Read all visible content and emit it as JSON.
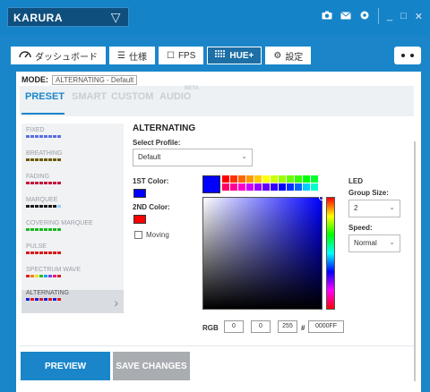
{
  "titlebar": {
    "device": "KARURA",
    "icons": [
      "camera-icon",
      "mail-icon",
      "gear-icon"
    ],
    "window_buttons": [
      "_",
      "□",
      "✕"
    ]
  },
  "tabs": [
    {
      "label": "ダッシュボード",
      "icon": "gauge-icon"
    },
    {
      "label": "仕様",
      "icon": "list-icon"
    },
    {
      "label": "FPS",
      "icon": "square-icon"
    },
    {
      "label": "HUE+",
      "icon": "grid-icon"
    },
    {
      "label": "設定",
      "icon": "gear-icon"
    }
  ],
  "mode": {
    "label": "MODE:",
    "value": "ALTERNATING - Default"
  },
  "subtabs": {
    "preset": "PRESET",
    "smart": "SMART",
    "custom": "CUSTOM",
    "audio": "AUDIO",
    "beta": "BETA"
  },
  "effects": [
    {
      "name": "FIXED",
      "colors": [
        "#5c6ee0"
      ]
    },
    {
      "name": "BREATHING",
      "colors": [
        "#6b5a00"
      ]
    },
    {
      "name": "FADING",
      "colors": [
        "#c21a3a"
      ]
    },
    {
      "name": "MARQUEE",
      "colors": [
        "#1a1a1a",
        "#1a1a1a",
        "#1a1a1a",
        "#8fd3ff"
      ]
    },
    {
      "name": "COVERING MARQUEE",
      "colors": [
        "#19b81e"
      ]
    },
    {
      "name": "PULSE",
      "colors": [
        "#d81a1a"
      ]
    },
    {
      "name": "SPECTRUM WAVE",
      "colors": [
        "#e02020",
        "#f08020",
        "#f0e020",
        "#20c020",
        "#20a0f0",
        "#8040e0"
      ]
    },
    {
      "name": "ALTERNATING",
      "colors": [
        "#1a1ae0",
        "#e01a1a"
      ]
    }
  ],
  "detail": {
    "title": "ALTERNATING",
    "select_profile_label": "Select Profile:",
    "profile_value": "Default",
    "color1_label": "1ST Color:",
    "color1": "#0000ff",
    "color2_label": "2ND Color:",
    "color2": "#ff0000",
    "moving_label": "Moving",
    "led_label": "LED",
    "group_size_label": "Group Size:",
    "group_size_value": "2",
    "speed_label": "Speed:",
    "speed_value": "Normal"
  },
  "palette": [
    "#ff0000",
    "#ff3300",
    "#ff6600",
    "#ff9900",
    "#ffcc00",
    "#ffff00",
    "#ccff00",
    "#99ff00",
    "#66ff00",
    "#33ff00",
    "#00ff00",
    "#00ff33",
    "#ff0066",
    "#ff0099",
    "#ff00cc",
    "#cc00ff",
    "#9900ff",
    "#6600ff",
    "#3300ff",
    "#0000ff",
    "#0033ff",
    "#0066ff",
    "#00ccff",
    "#00ffcc"
  ],
  "rgb": {
    "label": "RGB",
    "r": "0",
    "g": "0",
    "b": "255",
    "hash": "#",
    "hex": "0000FF"
  },
  "buttons": {
    "preview": "PREVIEW",
    "save": "SAVE CHANGES"
  }
}
